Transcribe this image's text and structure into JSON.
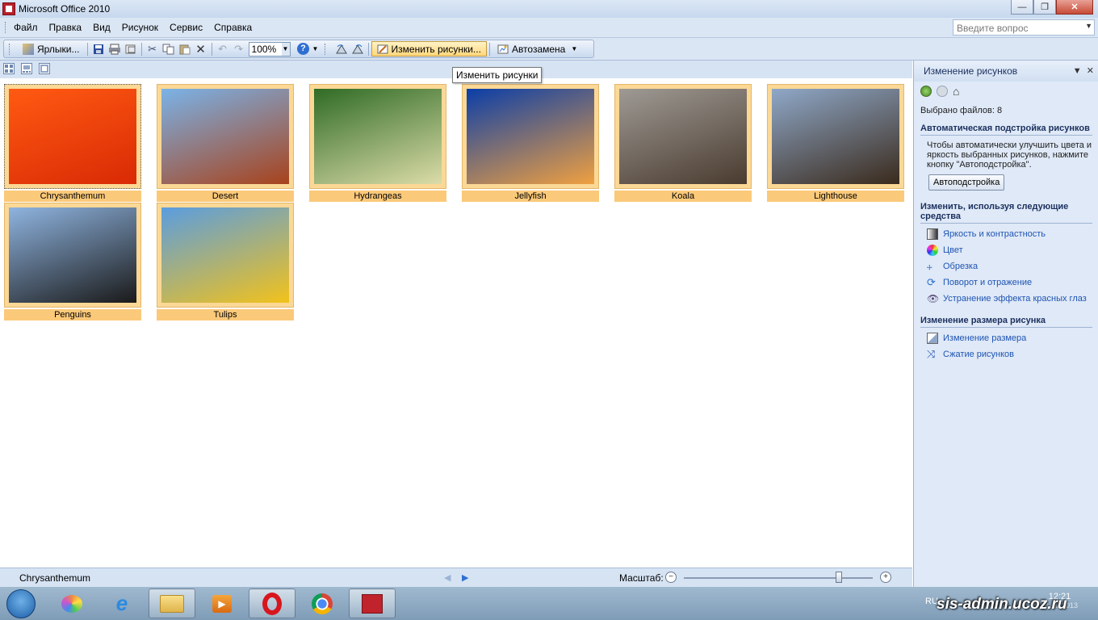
{
  "window": {
    "title": "Microsoft Office 2010"
  },
  "menu": {
    "items": [
      "Файл",
      "Правка",
      "Вид",
      "Рисунок",
      "Сервис",
      "Справка"
    ],
    "help_placeholder": "Введите вопрос"
  },
  "toolbar": {
    "shortcuts_label": "Ярлыки...",
    "zoom_value": "100%",
    "edit_pictures_label": "Изменить рисунки...",
    "autocorrect_label": "Автозамена",
    "tooltip": "Изменить рисунки"
  },
  "gallery": {
    "images": [
      {
        "name": "Chrysanthemum",
        "selected": true,
        "colors": [
          "#ff5a12",
          "#d92a05"
        ]
      },
      {
        "name": "Desert",
        "colors": [
          "#7ab3e8",
          "#a8421b"
        ]
      },
      {
        "name": "Hydrangeas",
        "colors": [
          "#2f6b25",
          "#dcdca8"
        ]
      },
      {
        "name": "Jellyfish",
        "colors": [
          "#0a3ea8",
          "#f0a040"
        ]
      },
      {
        "name": "Koala",
        "colors": [
          "#9e9a94",
          "#4a3b2f"
        ]
      },
      {
        "name": "Lighthouse",
        "colors": [
          "#8fa8c8",
          "#3a2a1c"
        ]
      },
      {
        "name": "Penguins",
        "colors": [
          "#8fb4e0",
          "#1a1a1a"
        ]
      },
      {
        "name": "Tulips",
        "colors": [
          "#5a9de0",
          "#f2c21b"
        ]
      }
    ]
  },
  "status": {
    "current_file": "Chrysanthemum",
    "zoom_label": "Масштаб:",
    "zoom_level": 0.82
  },
  "taskpane": {
    "title": "Изменение рисунков",
    "selected_files": "Выбрано файлов: 8",
    "auto_section": "Автоматическая подстройка рисунков",
    "auto_text": "Чтобы автоматически улучшить цвета и яркость выбранных рисунков, нажмите кнопку \"Автоподстройка\".",
    "auto_button": "Автоподстройка",
    "tools_section": "Изменить, используя следующие средства",
    "tools": [
      "Яркость и контрастность",
      "Цвет",
      "Обрезка",
      "Поворот и отражение",
      "Устранение эффекта красных глаз"
    ],
    "resize_section": "Изменение размера рисунка",
    "resize_links": [
      "Изменение размера",
      "Сжатие рисунков"
    ]
  },
  "taskbar": {
    "lang": "RU",
    "time": "12:21",
    "date": "21.02.2013",
    "watermark": "sis-admin.ucoz.ru"
  }
}
